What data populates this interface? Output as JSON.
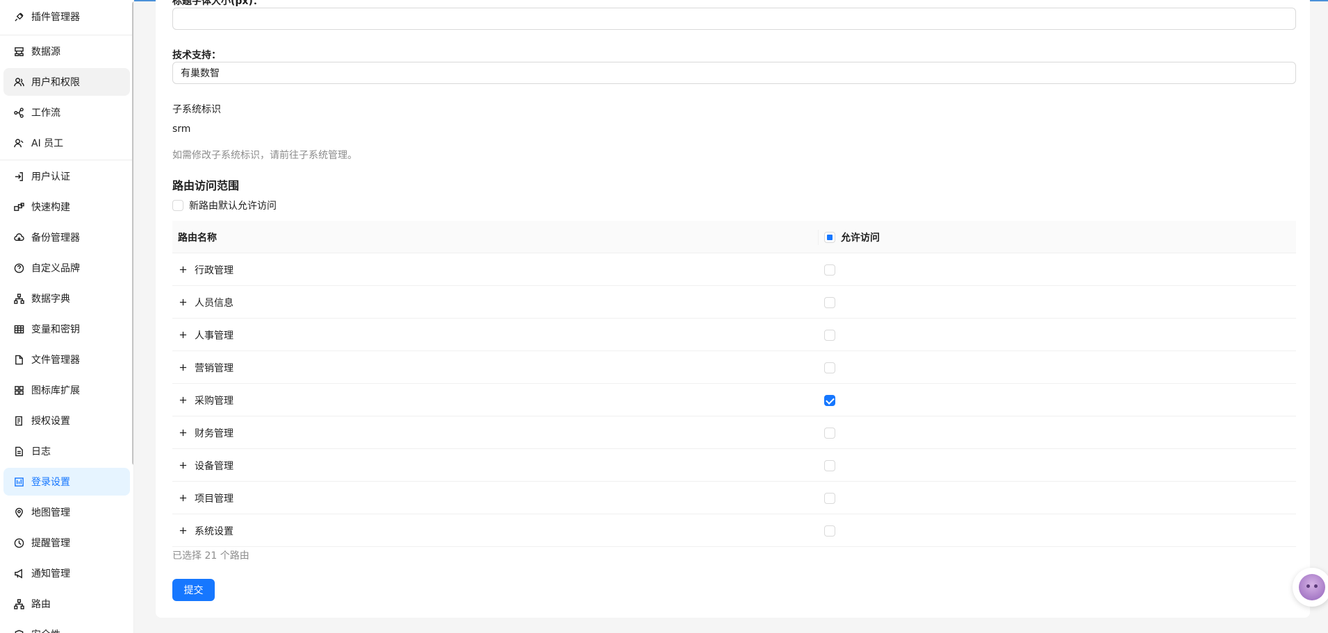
{
  "sidebar": {
    "items": [
      {
        "label": "插件管理器",
        "icon": "plug-icon"
      },
      {
        "label": "数据源",
        "icon": "database-icon"
      },
      {
        "label": "用户和权限",
        "icon": "users-icon"
      },
      {
        "label": "工作流",
        "icon": "workflow-icon"
      },
      {
        "label": "AI 员工",
        "icon": "ai-user-icon"
      },
      {
        "label": "用户认证",
        "icon": "login-icon"
      },
      {
        "label": "快速构建",
        "icon": "blocks-icon"
      },
      {
        "label": "备份管理器",
        "icon": "cloud-icon"
      },
      {
        "label": "自定义品牌",
        "icon": "question-circle-icon"
      },
      {
        "label": "数据字典",
        "icon": "sitemap-icon"
      },
      {
        "label": "变量和密钥",
        "icon": "table-icon"
      },
      {
        "label": "文件管理器",
        "icon": "file-icon"
      },
      {
        "label": "图标库扩展",
        "icon": "appstore-icon"
      },
      {
        "label": "授权设置",
        "icon": "license-icon"
      },
      {
        "label": "日志",
        "icon": "log-file-icon"
      },
      {
        "label": "登录设置",
        "icon": "login-settings-icon"
      },
      {
        "label": "地图管理",
        "icon": "map-pin-icon"
      },
      {
        "label": "提醒管理",
        "icon": "clock-icon"
      },
      {
        "label": "通知管理",
        "icon": "megaphone-icon"
      },
      {
        "label": "路由",
        "icon": "route-icon"
      },
      {
        "label": "安全性",
        "icon": "shield-icon"
      }
    ]
  },
  "form": {
    "title_font_label": "标题字体大小(px)：",
    "title_font_value": "",
    "support_label": "技术支持：",
    "support_value": "有巢数智",
    "subsystem_label": "子系统标识",
    "subsystem_value": "srm",
    "subsystem_hint": "如需修改子系统标识，请前往子系统管理。",
    "route_section_title": "路由访问范围",
    "default_allow_label": "新路由默认允许访问"
  },
  "table": {
    "col_name": "路由名称",
    "col_allow": "允许访问",
    "rows": [
      {
        "name": "行政管理",
        "allowed": false
      },
      {
        "name": "人员信息",
        "allowed": false
      },
      {
        "name": "人事管理",
        "allowed": false
      },
      {
        "name": "营销管理",
        "allowed": false
      },
      {
        "name": "采购管理",
        "allowed": true
      },
      {
        "name": "财务管理",
        "allowed": false
      },
      {
        "name": "设备管理",
        "allowed": false
      },
      {
        "name": "项目管理",
        "allowed": false
      },
      {
        "name": "系统设置",
        "allowed": false
      }
    ]
  },
  "footer": {
    "selected_text": "已选择 21 个路由",
    "submit_label": "提交"
  },
  "colors": {
    "primary": "#1677ff",
    "active_bg": "#e6f4ff",
    "hint": "#8c8c8c"
  }
}
